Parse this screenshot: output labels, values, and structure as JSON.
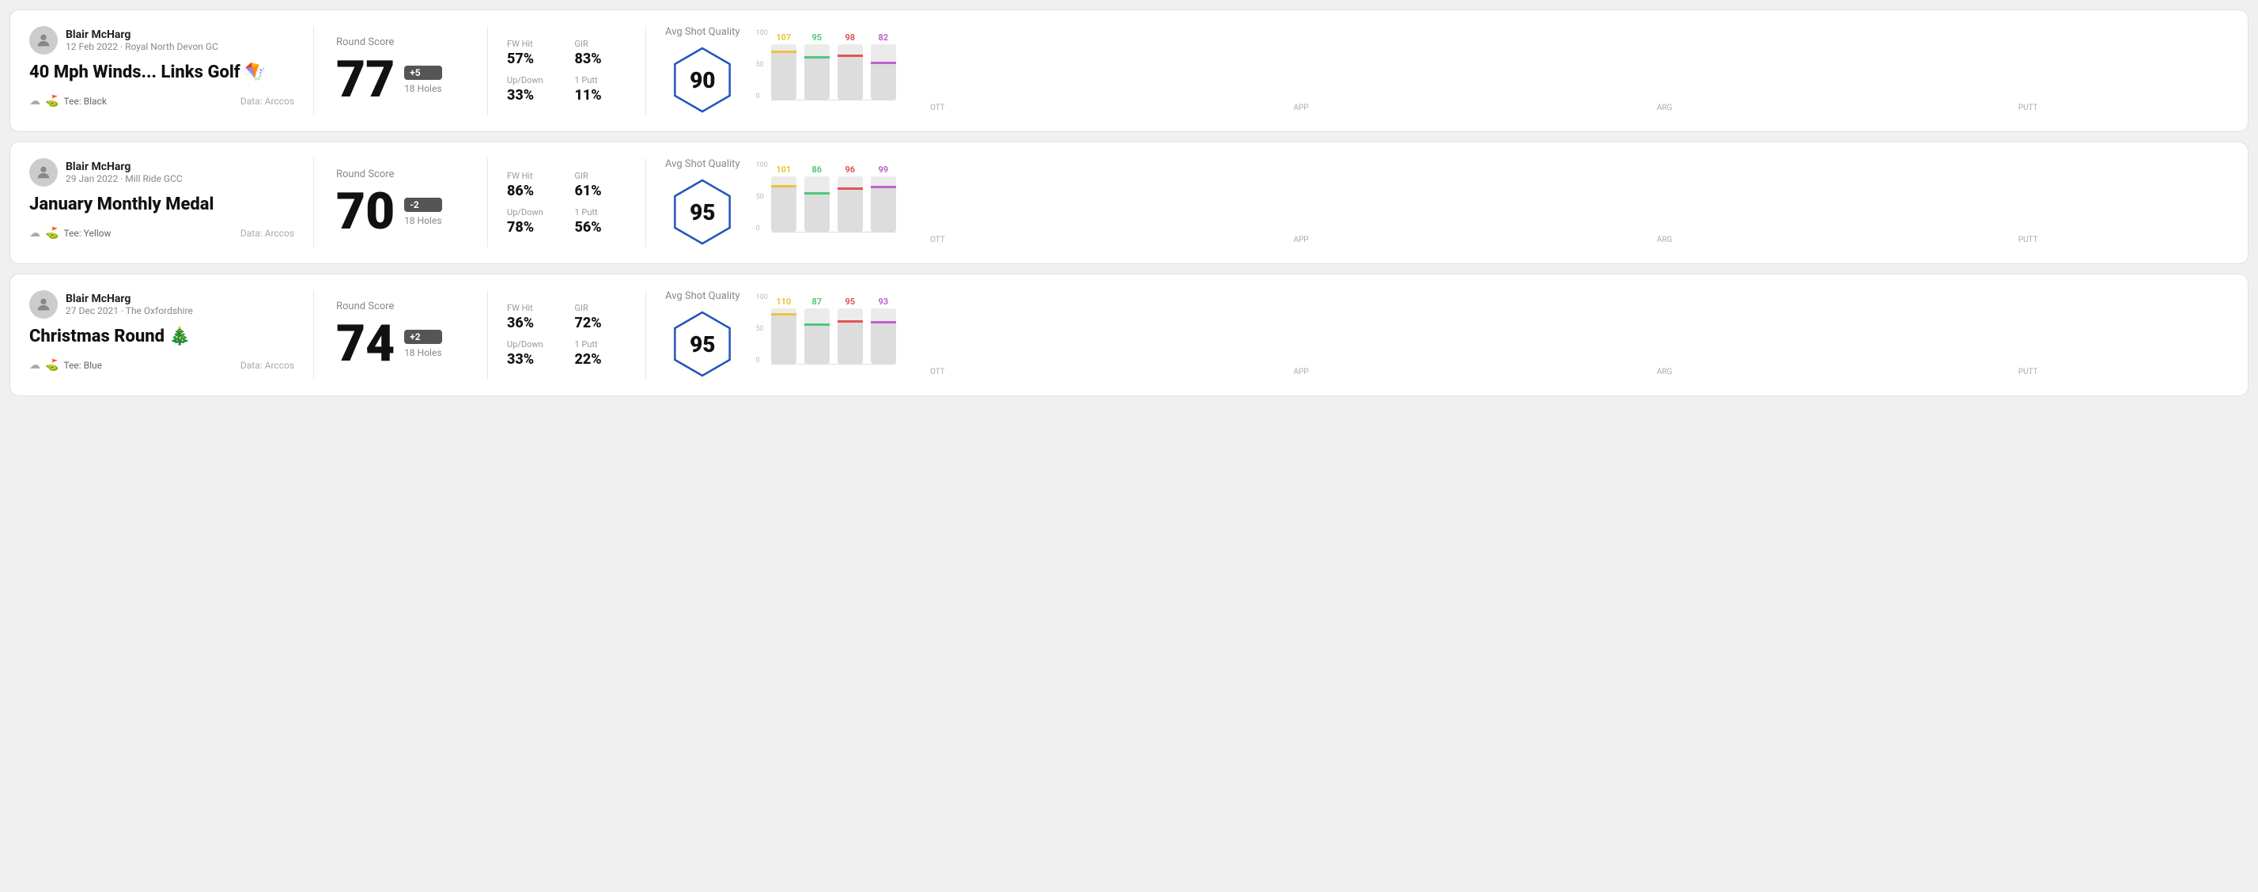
{
  "rounds": [
    {
      "id": "round1",
      "user": {
        "name": "Blair McHarg",
        "date": "12 Feb 2022 · Royal North Devon GC"
      },
      "title": "40 Mph Winds... Links Golf 🪁",
      "tee": "Black",
      "data_source": "Data: Arccos",
      "score": "77",
      "score_diff": "+5",
      "holes": "18 Holes",
      "fw_hit": "57%",
      "gir": "83%",
      "up_down": "33%",
      "one_putt": "11%",
      "avg_quality": "90",
      "chart": {
        "ott": {
          "value": 107,
          "color": "#f0c040"
        },
        "app": {
          "value": 95,
          "color": "#50c878"
        },
        "arg": {
          "value": 98,
          "color": "#e05555"
        },
        "putt": {
          "value": 82,
          "color": "#c060d0"
        }
      }
    },
    {
      "id": "round2",
      "user": {
        "name": "Blair McHarg",
        "date": "29 Jan 2022 · Mill Ride GCC"
      },
      "title": "January Monthly Medal",
      "tee": "Yellow",
      "data_source": "Data: Arccos",
      "score": "70",
      "score_diff": "-2",
      "holes": "18 Holes",
      "fw_hit": "86%",
      "gir": "61%",
      "up_down": "78%",
      "one_putt": "56%",
      "avg_quality": "95",
      "chart": {
        "ott": {
          "value": 101,
          "color": "#f0c040"
        },
        "app": {
          "value": 86,
          "color": "#50c878"
        },
        "arg": {
          "value": 96,
          "color": "#e05555"
        },
        "putt": {
          "value": 99,
          "color": "#c060d0"
        }
      }
    },
    {
      "id": "round3",
      "user": {
        "name": "Blair McHarg",
        "date": "27 Dec 2021 · The Oxfordshire"
      },
      "title": "Christmas Round 🎄",
      "tee": "Blue",
      "data_source": "Data: Arccos",
      "score": "74",
      "score_diff": "+2",
      "holes": "18 Holes",
      "fw_hit": "36%",
      "gir": "72%",
      "up_down": "33%",
      "one_putt": "22%",
      "avg_quality": "95",
      "chart": {
        "ott": {
          "value": 110,
          "color": "#f0c040"
        },
        "app": {
          "value": 87,
          "color": "#50c878"
        },
        "arg": {
          "value": 95,
          "color": "#e05555"
        },
        "putt": {
          "value": 93,
          "color": "#c060d0"
        }
      }
    }
  ],
  "labels": {
    "round_score": "Round Score",
    "fw_hit": "FW Hit",
    "gir": "GIR",
    "up_down": "Up/Down",
    "one_putt": "1 Putt",
    "avg_quality": "Avg Shot Quality",
    "ott": "OTT",
    "app": "APP",
    "arg": "ARG",
    "putt": "PUTT",
    "tee_prefix": "Tee:",
    "data_arccos": "Data: Arccos",
    "y100": "100",
    "y50": "50",
    "y0": "0"
  }
}
